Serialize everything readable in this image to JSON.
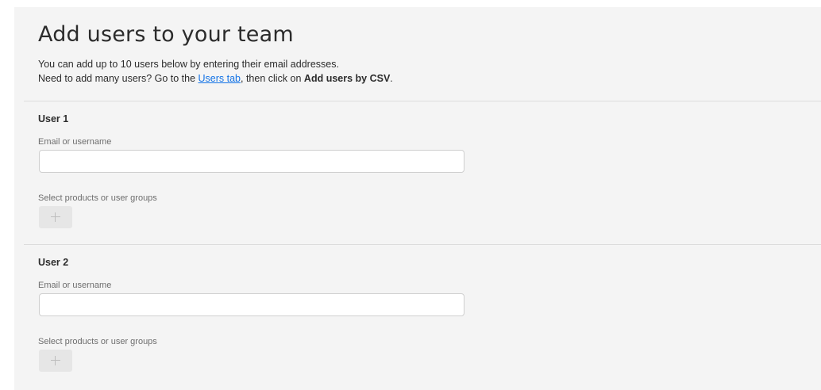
{
  "page": {
    "title": "Add users to your team",
    "intro_line1": "You can add up to 10 users below by entering their email addresses.",
    "intro_line2_before": "Need to add many users? Go to the ",
    "intro_link": "Users tab",
    "intro_line2_middle": ", then click on ",
    "intro_line2_bold": "Add users by CSV",
    "intro_line2_end": "."
  },
  "users": [
    {
      "heading": "User 1",
      "email_label": "Email or username",
      "email_value": "",
      "email_placeholder": "",
      "products_label": "Select products or user groups",
      "add_icon": "plus-icon"
    },
    {
      "heading": "User 2",
      "email_label": "Email or username",
      "email_value": "",
      "email_placeholder": "",
      "products_label": "Select products or user groups",
      "add_icon": "plus-icon"
    }
  ],
  "colors": {
    "panel_background": "#f4f4f4",
    "link": "#1473e6",
    "divider": "#dcdcdc",
    "input_border": "#cfcfcf",
    "disabled_button": "#e6e6e6"
  }
}
